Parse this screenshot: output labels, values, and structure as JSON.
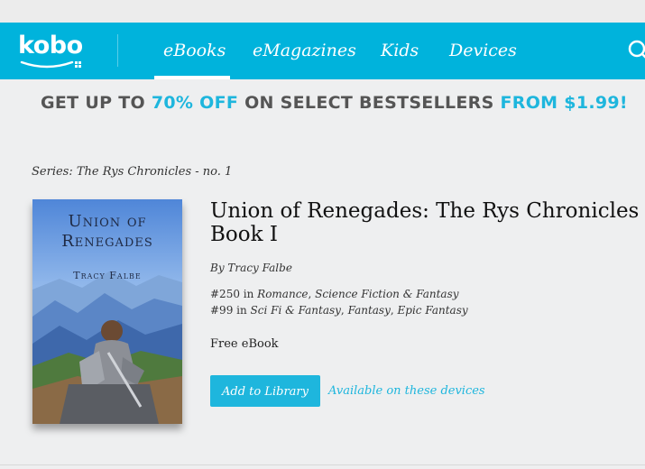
{
  "header": {
    "logo_text": "kobo",
    "nav": [
      {
        "label": "eBooks",
        "active": true
      },
      {
        "label": "eMagazines",
        "active": false
      },
      {
        "label": "Kids",
        "active": false
      },
      {
        "label": "Devices",
        "active": false
      }
    ],
    "search_icon": "search-icon",
    "colors": {
      "nav_bg": "#00b3dc",
      "accent": "#1eb6dd"
    }
  },
  "promo": {
    "part1": "GET UP TO ",
    "part2": "70% OFF",
    "part3": " ON SELECT BESTSELLERS ",
    "part4": "FROM $1.99!"
  },
  "series": "Series: The Rys Chronicles - no. 1",
  "book": {
    "cover_title_line1": "Union of",
    "cover_title_line2": "Renegades",
    "cover_author": "Tracy Falbe",
    "title": "Union of Renegades: The Rys Chronicles Book I",
    "author_prefix": "By ",
    "author": "Tracy Falbe",
    "rankings": [
      {
        "rank": "#250",
        "in": " in ",
        "categories": [
          "Romance",
          "Science Fiction & Fantasy"
        ]
      },
      {
        "rank": "#99",
        "in": " in ",
        "categories": [
          "Sci Fi & Fantasy",
          "Fantasy",
          "Epic Fantasy"
        ]
      }
    ],
    "price": "Free eBook"
  },
  "actions": {
    "add_label": "Add to Library",
    "available_label": "Available on these devices"
  }
}
